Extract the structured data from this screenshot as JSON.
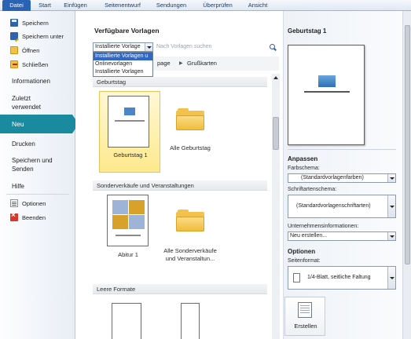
{
  "tabs": [
    "Datei",
    "Start",
    "Einfügen",
    "Seitenentwurf",
    "Sendungen",
    "Überprüfen",
    "Ansicht"
  ],
  "nav": {
    "commands_top": [
      "Speichern",
      "Speichern unter",
      "Öffnen",
      "Schließen"
    ],
    "informationen": "Informationen",
    "zuletzt": "Zuletzt verwendet",
    "neu": "Neu",
    "drucken": "Drucken",
    "speichern_senden": "Speichern und Senden",
    "hilfe": "Hilfe",
    "optionen": "Optionen",
    "beenden": "Beenden"
  },
  "middle": {
    "heading": "Verfügbare Vorlagen",
    "combo_value": "Installierte Vorlage",
    "search_placeholder": "Nach Vorlagen suchen",
    "dropdown_options": [
      "Installierte Vorlagen u",
      "Onlinevorlagen",
      "Installierte Vorlagen"
    ],
    "breadcrumb": [
      "page",
      "Grußkarten"
    ],
    "groups": [
      {
        "title": "Geburtstag",
        "items": [
          "Geburtstag  1",
          "Alle Geburtstag"
        ]
      },
      {
        "title": "Sonderverkäufe und Veranstaltungen",
        "items": [
          "Abitur 1",
          "Alle Sonderverkäufe und Veranstaltun..."
        ]
      },
      {
        "title": "Leere Formate",
        "items": []
      }
    ]
  },
  "right": {
    "title": "Geburtstag  1",
    "anpassen": "Anpassen",
    "farbschema_label": "Farbschema:",
    "farbschema_value": "(Standardvorlagenfarben)",
    "schriftschema_label": "Schriftartenschema:",
    "schriftschema_value": "(Standardvorlagenschriftarten)",
    "unternehmen_label": "Unternehmensinformationen:",
    "unternehmen_value": "Neu erstellen...",
    "optionen": "Optionen",
    "seitenformat_label": "Seitenformat:",
    "seitenformat_value": "1/4-Blatt, seitliche Faltung",
    "erstellen": "Erstellen"
  },
  "colors": {
    "selected_nav": "#1a8a9e",
    "file_tab": "#2a62b4",
    "tile_highlight": "#fde98d"
  }
}
